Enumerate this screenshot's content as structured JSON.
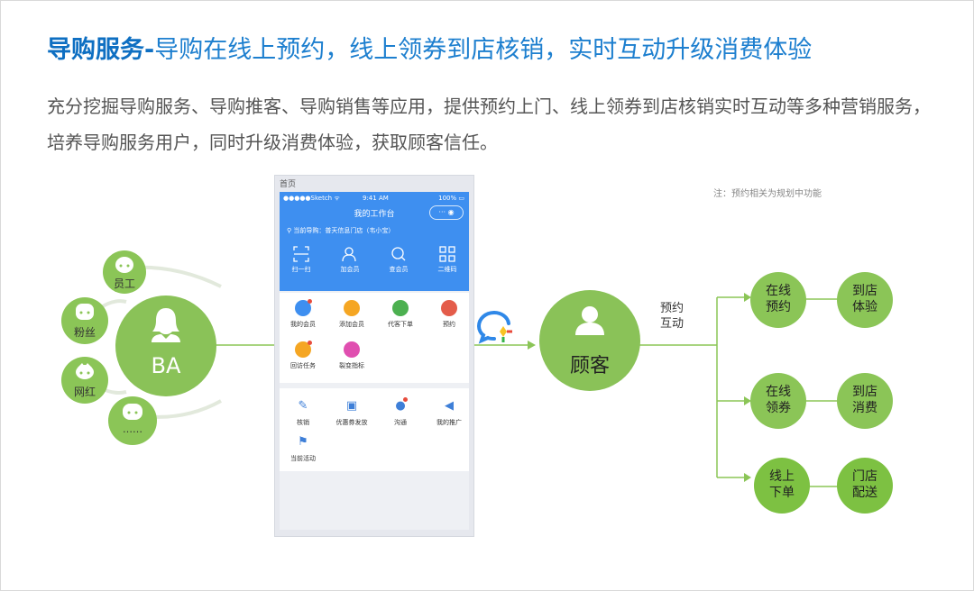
{
  "header": {
    "title_bold": "导购服务-",
    "title_rest": "导购在线上预约，线上领券到店核销，实时互动升级消费体验",
    "description": "充分挖掘导购服务、导购推客、导购销售等应用，提供预约上门、线上领券到店核销实时互动等多种营销服务，培养导购服务用户，同时升级消费体验，获取顾客信任。",
    "note": "注：预约相关为规划中功能"
  },
  "left_group": {
    "center_label": "BA",
    "satellites": [
      "员工",
      "粉丝",
      "网红",
      "……"
    ]
  },
  "phone": {
    "home_label": "首页",
    "status_left": "●●●●●Sketch ᯤ",
    "status_time": "9:41 AM",
    "status_right": "100% ▭",
    "title": "我的工作台",
    "pill": "··· ◉",
    "guide": "当前导购：普天信息门店（韦小宝）",
    "quick_actions": [
      "扫一扫",
      "加会员",
      "查会员",
      "二维码"
    ],
    "grid1": [
      "我的会员",
      "添加会员",
      "代客下单",
      "预约",
      "回访任务",
      "裂变指标"
    ],
    "grid2": [
      "核销",
      "优惠券发放",
      "沟通",
      "我的推广",
      "当前活动"
    ]
  },
  "center": {
    "label": "顾客",
    "interaction": [
      "预约",
      "互动"
    ]
  },
  "flows": [
    {
      "online": [
        "在线",
        "预约"
      ],
      "store": [
        "到店",
        "体验"
      ]
    },
    {
      "online": [
        "在线",
        "领券"
      ],
      "store": [
        "到店",
        "消费"
      ]
    },
    {
      "online": [
        "线上",
        "下单"
      ],
      "store": [
        "门店",
        "配送"
      ]
    }
  ],
  "colors": {
    "title_blue": "#1d7fcf",
    "green": "#8bc557",
    "phone_blue": "#3e8ff0"
  }
}
